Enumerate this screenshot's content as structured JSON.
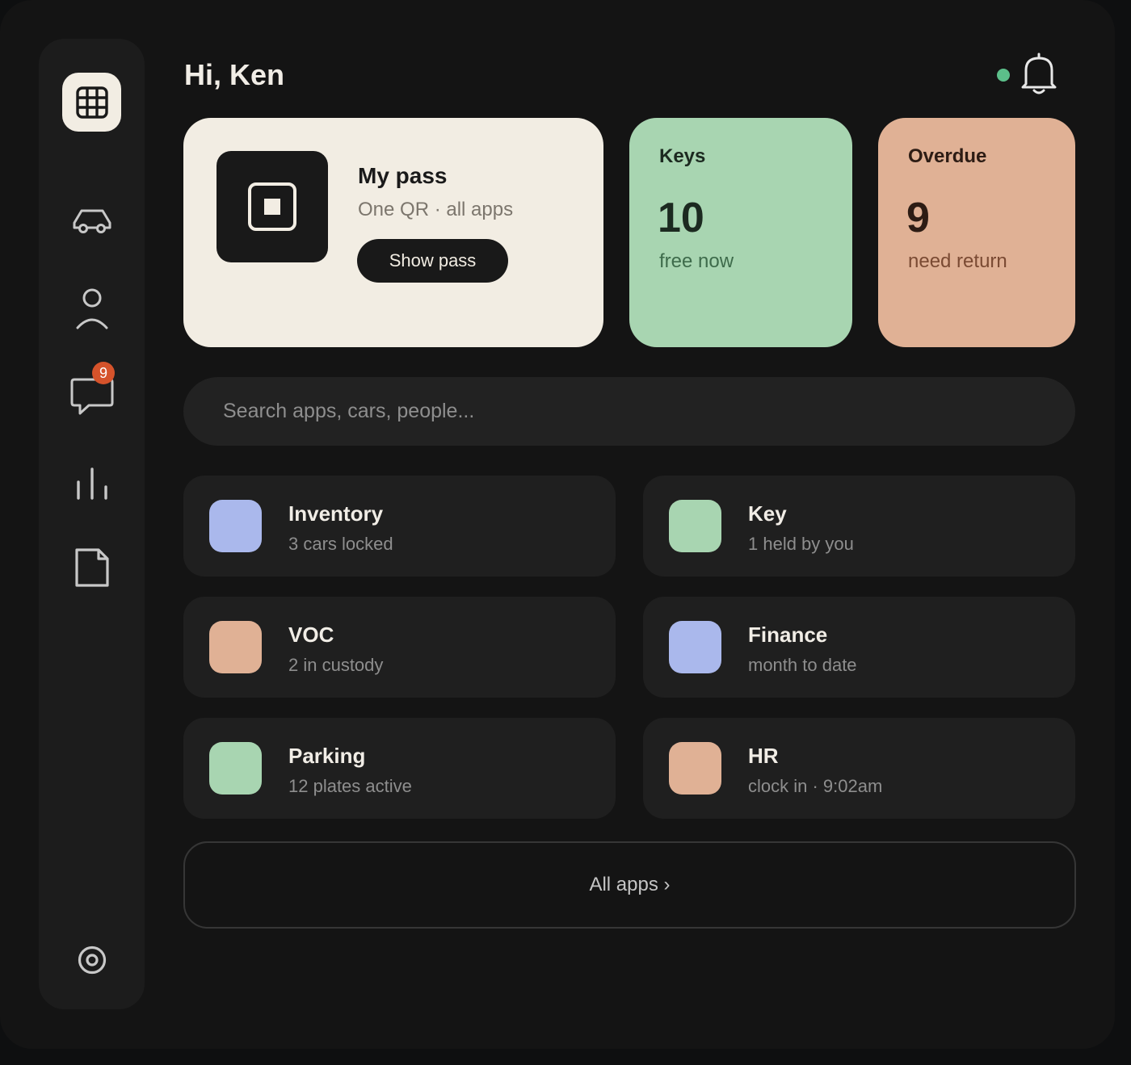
{
  "header": {
    "greeting": "Hi, Ken"
  },
  "sidebar": {
    "items": [
      {
        "name": "apps-grid-icon",
        "active": true
      },
      {
        "name": "car-icon",
        "active": false
      },
      {
        "name": "person-icon",
        "active": false
      },
      {
        "name": "chat-icon",
        "active": false,
        "badge": "9"
      },
      {
        "name": "bar-chart-icon",
        "active": false
      },
      {
        "name": "document-icon",
        "active": false
      }
    ],
    "footer_icon": "settings-icon"
  },
  "pass": {
    "title": "My pass",
    "subtitle": "One QR · all apps",
    "button": "Show pass"
  },
  "stats": {
    "keys": {
      "label": "Keys",
      "value": "10",
      "caption": "free now",
      "color": "#a8d5b1"
    },
    "overdue": {
      "label": "Overdue",
      "value": "9",
      "caption": "need return",
      "color": "#e0b195"
    }
  },
  "search": {
    "placeholder": "Search apps, cars, people..."
  },
  "apps": [
    {
      "name": "Inventory",
      "sub": "3 cars locked",
      "color": "#aab8ec"
    },
    {
      "name": "Key",
      "sub": "1 held by you",
      "color": "#a8d5b1"
    },
    {
      "name": "VOC",
      "sub": "2 in custody",
      "color": "#e0b195"
    },
    {
      "name": "Finance",
      "sub": "month to date",
      "color": "#aab8ec"
    },
    {
      "name": "Parking",
      "sub": "12 plates active",
      "color": "#a8d5b1"
    },
    {
      "name": "HR",
      "sub": "clock in · 9:02am",
      "color": "#e0b195"
    }
  ],
  "all_apps_label": "All apps ›"
}
